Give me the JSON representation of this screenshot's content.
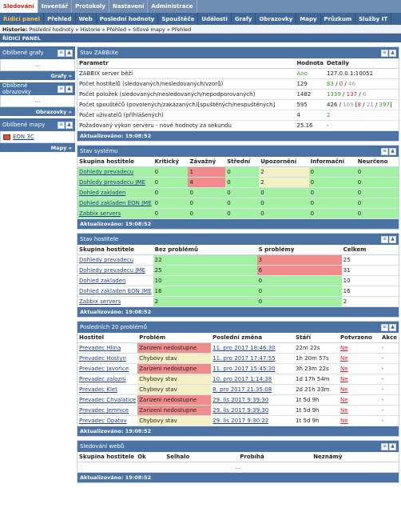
{
  "topnav": [
    "Sledování",
    "Inventář",
    "Protokoly",
    "Nastavení",
    "Administrace"
  ],
  "subnav": [
    "Řídicí panel",
    "Přehled",
    "Web",
    "Poslední hodnoty",
    "Spouštěče",
    "Události",
    "Grafy",
    "Obrazovky",
    "Mapy",
    "Průzkum",
    "Služby IT"
  ],
  "breadcrumb": {
    "label": "Historie:",
    "items": "Poslední hodnoty » Historie » Přehled » Síťové mapy » Přehled"
  },
  "page_title": "ŘÍDICÍ PANEL",
  "sidebar": {
    "graphs": {
      "title": "Oblíbené grafy",
      "body": "...",
      "footer": "Grafy »"
    },
    "screens": {
      "title": "Oblíbené obrazovky",
      "body": "...",
      "footer": "Obrazovky »"
    },
    "maps": {
      "title": "Oblíbené mapy",
      "link": "EON 3C",
      "footer": "Mapy »"
    }
  },
  "zabbix_status": {
    "title": "Stav ZABBIXe",
    "headers": [
      "Parametr",
      "Hodnota",
      "Detaily"
    ],
    "rows": [
      {
        "p": "ZABBIX server běží",
        "v": "Ano",
        "d": "127.0.0.1:10051"
      },
      {
        "p": "Počet hostitelů (sledovaných/nesledovaných/vzorů)",
        "v": "129",
        "d1": "83",
        "d2": "0",
        "d3": "46"
      },
      {
        "p": "Počet položek (sledovaných/nesledovaných/nepodporovaných)",
        "v": "1482",
        "d1": "1339",
        "d2": "137",
        "d3": "6"
      },
      {
        "p": "Počet spouštěčů (povolených/zakázaných)[spuštěných/nespuštěných]",
        "v": "595",
        "d1": "426",
        "d2": "169",
        "d3": "8",
        "d4": "21",
        "d5": "397"
      },
      {
        "p": "Počet uživatelů (přihlášených)",
        "v": "4",
        "d": "2"
      },
      {
        "p": "Požadovaný výkon serveru - nové hodnoty za sekundu",
        "v": "25.16",
        "d": "-"
      }
    ],
    "updated": "Aktualizováno: 19:08:52"
  },
  "system_status": {
    "title": "Stav systému",
    "headers": [
      "Skupina hostitele",
      "Kritický",
      "Závažný",
      "Střední",
      "Upozornění",
      "Informační",
      "Neurčeno"
    ],
    "rows": [
      [
        "Dohledy prevadecu",
        "0",
        "1",
        "0",
        "2",
        "0",
        "0"
      ],
      [
        "Dohledy prevadecu JME",
        "0",
        "4",
        "0",
        "2",
        "0",
        "0"
      ],
      [
        "Dohled zakladen",
        "0",
        "0",
        "0",
        "0",
        "0",
        "0"
      ],
      [
        "Dohled zakladen EON JME",
        "0",
        "0",
        "0",
        "0",
        "0",
        "0"
      ],
      [
        "Zabbix servers",
        "0",
        "0",
        "0",
        "0",
        "0",
        "0"
      ]
    ],
    "updated": "Aktualizováno: 19:08:52"
  },
  "host_status": {
    "title": "Stav hostitele",
    "headers": [
      "Skupina hostitele",
      "Bez problémů",
      "S problémy",
      "Celkem"
    ],
    "rows": [
      [
        "Dohledy prevadecu",
        "22",
        "3",
        "25"
      ],
      [
        "Dohledy prevadecu JME",
        "25",
        "6",
        "31"
      ],
      [
        "Dohled zakladen",
        "10",
        "0",
        "10"
      ],
      [
        "Dohled zakladen EON JME",
        "16",
        "0",
        "16"
      ],
      [
        "Zabbix servers",
        "2",
        "0",
        "2"
      ]
    ],
    "updated": "Aktualizováno: 19:08:52"
  },
  "last_problems": {
    "title": "Posledních 20 problémů",
    "headers": [
      "Hostitel",
      "Problém",
      "Poslední změna",
      "Stáří",
      "Potvrzeno",
      "Akce"
    ],
    "rows": [
      [
        "Prevadec Hlina",
        "Zarizeni nedostupne",
        "11. pro 2017 18:46:30",
        "22m 22s",
        "Ne",
        "-"
      ],
      [
        "Prevadec Hostyn",
        "Chybovy stav",
        "11. pro 2017 17:47:55",
        "1h 20m 57s",
        "Ne",
        "-"
      ],
      [
        "Prevadec Javorice",
        "Zarizeni nedostupne",
        "11. pro 2017 15:45:30",
        "3h 23m 22s",
        "Ne",
        "-"
      ],
      [
        "Prevadec zalozni",
        "Chybovy stav",
        "10. pro 2017 1:14:38",
        "1d 17h 54m",
        "Ne",
        "-"
      ],
      [
        "Prevadec Klet",
        "Chybovy stav",
        "8. pro 2017 21:35:08",
        "2d 21h 33m",
        "Ne",
        "-"
      ],
      [
        "Prevadec Chvalatice",
        "Zarizeni nedostupne",
        "29. lis 2017 9:39:30",
        "1t 5d 9h",
        "Ne",
        "-"
      ],
      [
        "Prevadec Jemnice",
        "Zarizeni nedostupne",
        "29. lis 2017 9:39:30",
        "1t 5d 9h",
        "Ne",
        "-"
      ],
      [
        "Prevadec Opatov",
        "Chybovy stav",
        "29. lis 2017 9:30:22",
        "1t 5d 9h",
        "Ne",
        "-"
      ]
    ],
    "severity": [
      "high",
      "avg",
      "high",
      "avg",
      "avg",
      "high",
      "high",
      "avg"
    ],
    "updated": "Aktualizováno: 19:08:52"
  },
  "web_monitoring": {
    "title": "Sledování webů",
    "headers": [
      "Skupina hostitele",
      "Ok",
      "Selhalo",
      "Probíhá",
      "Neznámý"
    ],
    "body": "...",
    "updated": "Aktualizováno: 19:08:52"
  },
  "colors": {
    "ok": "#a3f0a3",
    "problem": "#f08c8c",
    "warning": "#f3f0c6",
    "header": "#4a73a3"
  }
}
